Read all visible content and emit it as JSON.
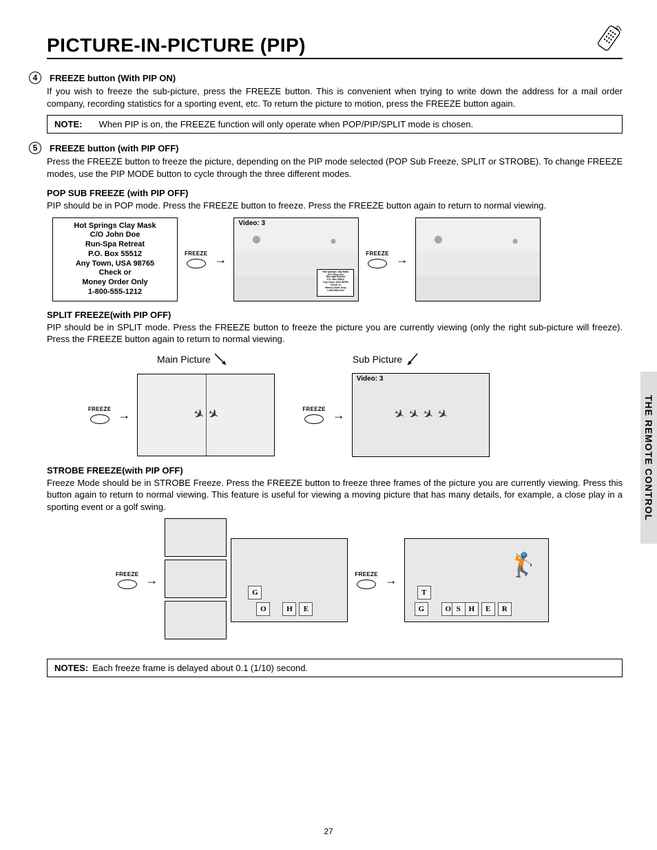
{
  "header": {
    "title": "PICTURE-IN-PICTURE (PIP)"
  },
  "section4": {
    "num": "4",
    "heading": "FREEZE button (With PIP ON)",
    "para": "If you wish to freeze the sub-picture, press the FREEZE button. This is convenient when trying to write down the address for a mail order company, recording statistics for a sporting event, etc.  To return the picture to motion, press the FREEZE button again."
  },
  "note1": {
    "label": "NOTE:",
    "text": "When PIP is on, the FREEZE function will only operate when POP/PIP/SPLIT mode is chosen."
  },
  "section5": {
    "num": "5",
    "heading": "FREEZE button (with PIP OFF)",
    "para": "Press the FREEZE button to freeze the picture, depending on the PIP mode selected (POP Sub Freeze, SPLIT or STROBE). To change FREEZE modes, use the PIP MODE button to cycle through the three different modes."
  },
  "pop": {
    "heading": "POP SUB FREEZE (with PIP OFF)",
    "para": "PIP should be in POP mode.  Press the FREEZE button to freeze.  Press the FREEZE button again to return to normal viewing.",
    "address": {
      "l1": "Hot Springs Clay Mask",
      "l2": "C/O John Doe",
      "l3": "Run-Spa Retreat",
      "l4": "P.O. Box 55512",
      "l5": "Any Town, USA 98765",
      "l6": "Check or",
      "l7": "Money Order Only",
      "l8": "1-800-555-1212"
    },
    "video_label": "Video: 3"
  },
  "split": {
    "heading": "SPLIT FREEZE(with PIP OFF)",
    "para": "PIP should be in SPLIT mode.  Press the FREEZE button to freeze the picture you are currently viewing (only the right sub-picture will freeze).  Press the FREEZE button again to return to normal viewing.",
    "main_label": "Main Picture",
    "sub_label": "Sub Picture",
    "video_label": "Video: 3"
  },
  "strobe": {
    "heading": "STROBE FREEZE(with PIP OFF)",
    "para": "Freeze Mode should be in STROBE Freeze.  Press the FREEZE button to freeze three frames of the picture you are currently viewing. Press this button again to return to normal viewing. This feature is useful for viewing a moving picture that has many details, for example, a close play in a sporting event or a golf swing."
  },
  "note2": {
    "label": "NOTES:",
    "text": "Each freeze frame is delayed about 0.1 (1/10) second."
  },
  "freeze_label": "FREEZE",
  "side_tab": "THE REMOTE CONTROL",
  "page_number": "27"
}
